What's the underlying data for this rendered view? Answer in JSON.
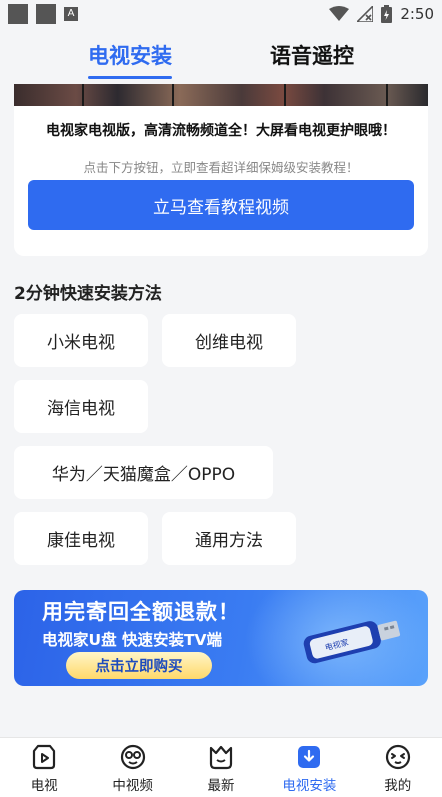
{
  "status_bar": {
    "time": "2:50",
    "notif_letter": "A"
  },
  "tabs": [
    {
      "label": "电视安装",
      "active": true
    },
    {
      "label": "语音遥控",
      "active": false
    }
  ],
  "card": {
    "title": "电视家电视版，高清流畅频道全！大屏看电视更护眼哦！",
    "subtitle": "点击下方按钮，立即查看超详细保姆级安装教程！",
    "button": "立马查看教程视频"
  },
  "section": {
    "title": "2分钟快速安装方法"
  },
  "methods": [
    "小米电视",
    "创维电视",
    "海信电视",
    "华为／天猫魔盒／OPPO",
    "康佳电视",
    "通用方法"
  ],
  "banner": {
    "headline": "用完寄回全额退款！",
    "subline": "电视家U盘 快速安装TV端",
    "button": "点击立即购买",
    "usb_text": "电视家"
  },
  "bottom_nav": [
    {
      "label": "电视",
      "icon": "tv-play-icon",
      "active": false
    },
    {
      "label": "中视频",
      "icon": "face-video-icon",
      "active": false
    },
    {
      "label": "最新",
      "icon": "crown-basket-icon",
      "active": false
    },
    {
      "label": "电视安装",
      "icon": "download-icon",
      "active": true
    },
    {
      "label": "我的",
      "icon": "profile-face-icon",
      "active": false
    }
  ],
  "colors": {
    "accent": "#2f6bf0",
    "background": "#f4f5f7"
  }
}
